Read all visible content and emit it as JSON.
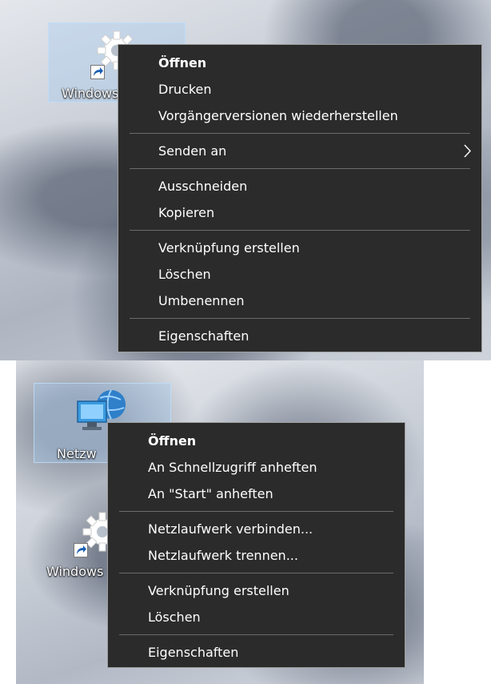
{
  "screens": [
    {
      "icon_label": "Windows",
      "menu": [
        {
          "type": "item",
          "label": "Öffnen",
          "bold": true
        },
        {
          "type": "item",
          "label": "Drucken"
        },
        {
          "type": "item",
          "label": "Vorgängerversionen wiederherstellen"
        },
        {
          "type": "sep"
        },
        {
          "type": "item",
          "label": "Senden an",
          "submenu": true
        },
        {
          "type": "sep"
        },
        {
          "type": "item",
          "label": "Ausschneiden"
        },
        {
          "type": "item",
          "label": "Kopieren"
        },
        {
          "type": "sep"
        },
        {
          "type": "item",
          "label": "Verknüpfung erstellen"
        },
        {
          "type": "item",
          "label": "Löschen"
        },
        {
          "type": "item",
          "label": "Umbenennen"
        },
        {
          "type": "sep"
        },
        {
          "type": "item",
          "label": "Eigenschaften"
        }
      ]
    },
    {
      "icon_label": "Netzw",
      "second_icon_label": "Windows",
      "menu": [
        {
          "type": "item",
          "label": "Öffnen",
          "bold": true
        },
        {
          "type": "item",
          "label": "An Schnellzugriff anheften"
        },
        {
          "type": "item",
          "label": "An \"Start\" anheften"
        },
        {
          "type": "sep"
        },
        {
          "type": "item",
          "label": "Netzlaufwerk verbinden..."
        },
        {
          "type": "item",
          "label": "Netzlaufwerk trennen..."
        },
        {
          "type": "sep"
        },
        {
          "type": "item",
          "label": "Verknüpfung erstellen"
        },
        {
          "type": "item",
          "label": "Löschen"
        },
        {
          "type": "sep"
        },
        {
          "type": "item",
          "label": "Eigenschaften"
        }
      ]
    }
  ],
  "icons": {
    "gear": "gear-icon",
    "network": "network-computer-icon",
    "shortcut": "shortcut-arrow-icon",
    "submenu": "chevron-right-icon"
  },
  "colors": {
    "menu_bg": "#2b2b2b",
    "menu_text": "#ffffff",
    "selection": "#9fc8f0"
  }
}
